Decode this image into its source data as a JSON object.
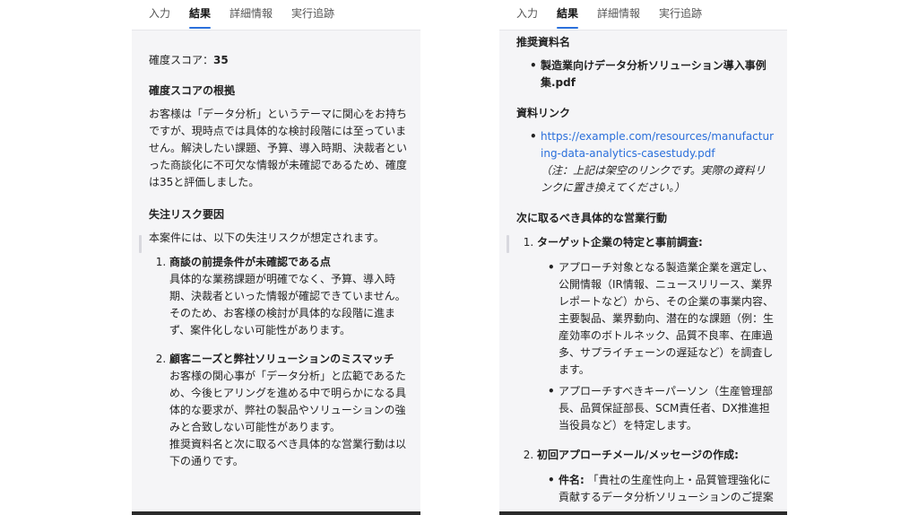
{
  "tabs": [
    "入力",
    "結果",
    "詳細情報",
    "実行追跡"
  ],
  "active_tab": "結果",
  "left": {
    "score_label": "確度スコア：",
    "score_value": "35",
    "basis_heading": "確度スコアの根拠",
    "basis_text": "お客様は「データ分析」というテーマに関心をお持ちですが、現時点では具体的な検討段階には至っていません。解決したい課題、予算、導入時期、決裁者といった商談化に不可欠な情報が未確認であるため、確度は35と評価しました。",
    "risk_heading": "失注リスク要因",
    "risk_intro": "本案件には、以下の失注リスクが想定されます。",
    "risks": [
      {
        "title": "商談の前提条件が未確認である点",
        "text": "具体的な業務課題が明確でなく、予算、導入時期、決裁者といった情報が確認できていません。そのため、お客様の検討が具体的な段階に進まず、案件化しない可能性があります。"
      },
      {
        "title": "顧客ニーズと弊社ソリューションのミスマッチ",
        "text": "お客様の関心事が「データ分析」と広範であるため、今後ヒアリングを進める中で明らかになる具体的な要求が、弊社の製品やソリューションの強みと合致しない可能性があります。",
        "trailing": "推奨資料名と次に取るべき具体的な営業行動は以下の通りです。"
      }
    ]
  },
  "right": {
    "doc_heading": "推奨資料名",
    "doc_name": "製造業向けデータ分析ソリューション導入事例集.pdf",
    "link_heading": "資料リンク",
    "link_url": "https://example.com/resources/manufacturing-data-analytics-casestudy.pdf",
    "link_note": "（注：上記は架空のリンクです。実際の資料リンクに置き換えてください。）",
    "actions_heading": "次に取るべき具体的な営業行動",
    "actions": [
      {
        "title": "ターゲット企業の特定と事前調査:",
        "bullets": [
          "アプローチ対象となる製造業企業を選定し、公開情報（IR情報、ニュースリリース、業界レポートなど）から、その企業の事業内容、主要製品、業界動向、潜在的な課題（例：生産効率のボトルネック、品質不良率、在庫過多、サプライチェーンの遅延など）を調査します。",
          "アプローチすべきキーパーソン（生産管理部長、品質保証部長、SCM責任者、DX推進担当役員など）を特定します。"
        ]
      },
      {
        "title": "初回アプローチメール/メッセージの作成:",
        "bullets": [
          {
            "label": "件名:",
            "text": "「貴社の生産性向上・品質管理強化に貢献するデータ分析ソリューションのご提案"
          }
        ]
      }
    ]
  }
}
